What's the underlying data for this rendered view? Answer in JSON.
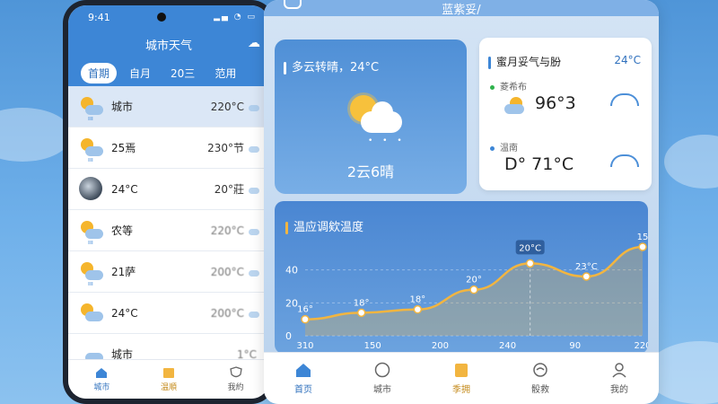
{
  "colors": {
    "primary": "#3d86d6",
    "accent": "#f2b540",
    "sun": "#f5b52c"
  },
  "phone": {
    "status_time": "9:41",
    "header_title": "城市天气",
    "tabs": [
      "首期",
      "自月",
      "20三",
      "范用"
    ],
    "cities": [
      {
        "name": "城市",
        "temp": "220°C",
        "icon": "partly-cloudy-rain-icon"
      },
      {
        "name": "25焉",
        "temp": "230°节",
        "icon": "partly-cloudy-rain-icon"
      },
      {
        "name": "24°C",
        "temp": "20°莊",
        "icon": "moon-icon"
      },
      {
        "name": "农等",
        "temp": "220°C",
        "icon": "cloud-rain-icon"
      },
      {
        "name": "21萨",
        "temp": "200°C",
        "icon": "cloud-rain-icon"
      },
      {
        "name": "24°C",
        "temp": "200°C",
        "icon": "partly-cloudy-icon"
      },
      {
        "name": "城市",
        "temp": "1°C",
        "icon": "cloud-icon"
      }
    ],
    "nav": [
      {
        "label": "城市",
        "icon": "home-icon"
      },
      {
        "label": "温順",
        "icon": "calendar-icon"
      },
      {
        "label": "我約",
        "icon": "shield-icon"
      }
    ]
  },
  "card": {
    "title": "蓝紫妥/",
    "weather": {
      "title": "多云转晴，24°C",
      "desc": "2云6晴"
    },
    "forecast": {
      "title": "蜜月妥气与肦",
      "temp_top": "24°C",
      "locations": [
        {
          "name": "菱希布",
          "value": "96°3"
        },
        {
          "name": "温南",
          "value": "D° 71°C"
        }
      ]
    },
    "chart_title": "温应调欸温度",
    "nav": [
      {
        "label": "首页",
        "icon": "home-icon"
      },
      {
        "label": "城市",
        "icon": "circle-icon"
      },
      {
        "label": "季拥",
        "icon": "calendar-icon"
      },
      {
        "label": "骰救",
        "icon": "wind-icon"
      },
      {
        "label": "我的",
        "icon": "user-icon"
      }
    ]
  },
  "chart_data": {
    "type": "line",
    "title": "温应调欸温度",
    "x_ticks": [
      "310",
      "150",
      "200",
      "240",
      "90",
      "220"
    ],
    "y_ticks": [
      "0",
      "20",
      "40"
    ],
    "points": [
      {
        "label": "16°",
        "y": 10
      },
      {
        "label": "18°",
        "y": 14
      },
      {
        "label": "18°",
        "y": 16
      },
      {
        "label": "20°",
        "y": 28
      },
      {
        "label": "20°C",
        "y": 44
      },
      {
        "label": "23°C",
        "y": 36
      },
      {
        "label": "15",
        "y": 54
      }
    ],
    "ylim": [
      0,
      60
    ]
  }
}
